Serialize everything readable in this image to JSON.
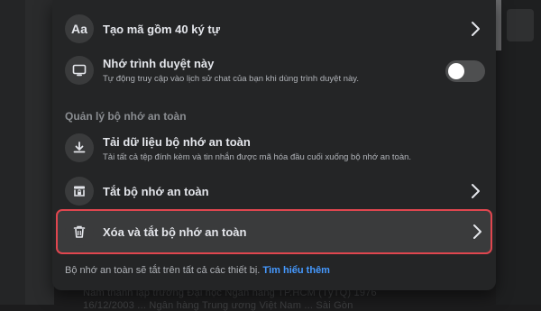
{
  "colors": {
    "panel_bg": "#242526",
    "icon_bg": "#3a3b3c",
    "highlight_border": "#e0464f",
    "link": "#4599ff",
    "toggle_off": "#4e4f50"
  },
  "rows": {
    "code40": {
      "icon_text": "Aa",
      "icon": "text-aa-icon",
      "title": "Tạo mã gồm 40 ký tự"
    },
    "remember": {
      "icon": "monitor-icon",
      "title": "Nhớ trình duyệt này",
      "subtitle": "Tự động truy cập vào lịch sử chat của bạn khi dùng trình duyệt này.",
      "toggle_on": false
    },
    "section_label": "Quản lý bộ nhớ an toàn",
    "download": {
      "icon": "download-icon",
      "title": "Tải dữ liệu bộ nhớ an toàn",
      "subtitle": "Tải tất cả tệp đính kèm và tin nhắn được mã hóa đầu cuối xuống bộ nhớ an toàn."
    },
    "disable": {
      "icon": "storage-off-icon",
      "title": "Tắt bộ nhớ an toàn"
    },
    "delete": {
      "icon": "trash-icon",
      "title": "Xóa và tắt bộ nhớ an toàn"
    }
  },
  "footer": {
    "text": "Bộ nhớ an toàn sẽ tắt trên tất cả các thiết bị.",
    "link": "Tìm hiểu thêm"
  },
  "background": {
    "line1": "Năm thành lập trường Đại học Ngân hàng TP.HCM (TỷTQ) 1976",
    "line2": "16/12/2003 ... Ngân hàng Trung ương Việt Nam ... Sài Gòn"
  }
}
